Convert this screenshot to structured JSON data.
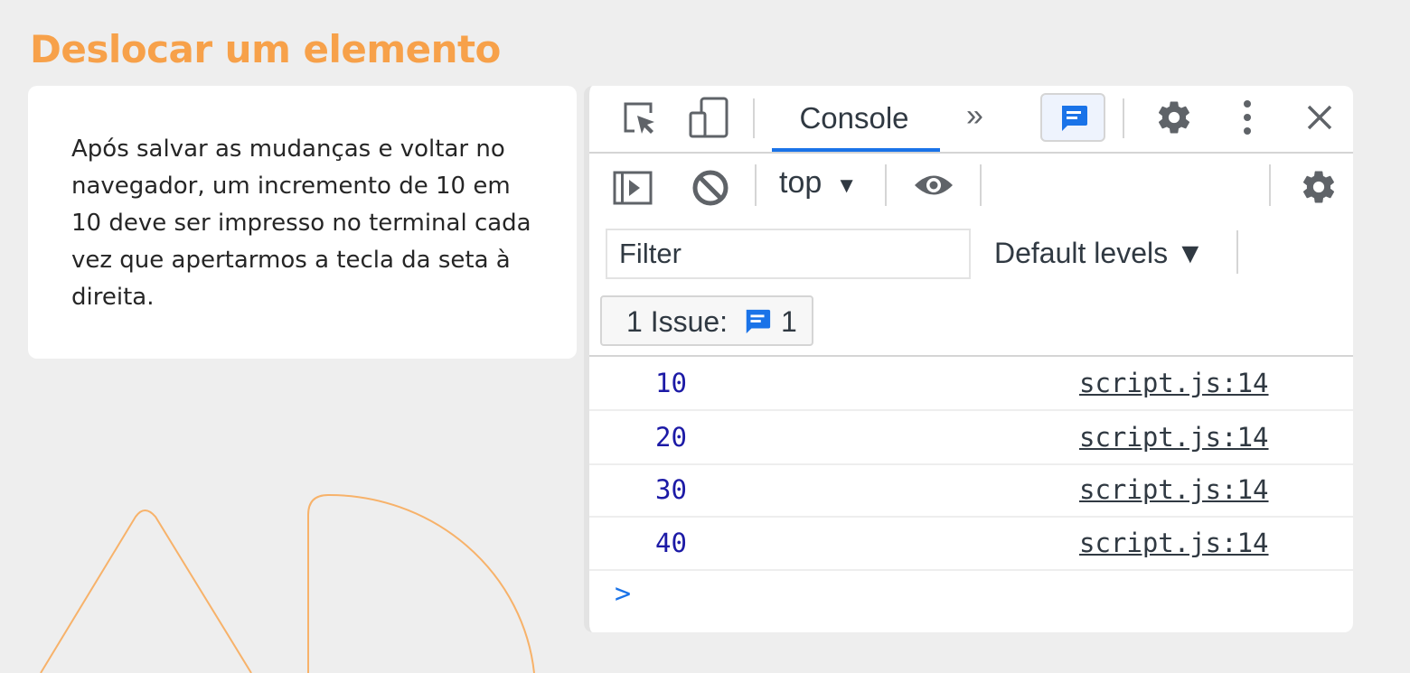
{
  "slide": {
    "title": "Deslocar um elemento",
    "body": "Após salvar as mudanças e voltar no navegador, um incremento de 10 em 10 deve ser impresso no terminal cada vez que apertarmos a tecla da seta à direita."
  },
  "colors": {
    "accent": "#f7a14a",
    "background": "#eeeeee",
    "devtools_blue": "#1a73e8",
    "log_value": "#1c1aa6"
  },
  "devtools": {
    "tabbar": {
      "inspect_icon": "select-element-icon",
      "device_icon": "device-toolbar-icon",
      "active_tab": "Console",
      "more_tabs": "»",
      "messages_icon": "message-icon",
      "settings_icon": "gear-icon",
      "menu_icon": "more-vertical-icon",
      "close_icon": "close-icon"
    },
    "toolbar": {
      "sidebar_icon": "show-sidebar-icon",
      "clear_icon": "clear-console-icon",
      "context": "top",
      "context_arrow": "▼",
      "eye_icon": "live-expression-icon",
      "settings_icon": "gear-icon"
    },
    "filter": {
      "placeholder": "Filter",
      "levels": "Default levels ▼"
    },
    "issues": {
      "label": "1 Issue:",
      "count": "1"
    },
    "logs": [
      {
        "value": "10",
        "source": "script.js:14"
      },
      {
        "value": "20",
        "source": "script.js:14"
      },
      {
        "value": "30",
        "source": "script.js:14"
      },
      {
        "value": "40",
        "source": "script.js:14"
      }
    ],
    "prompt": ">"
  }
}
